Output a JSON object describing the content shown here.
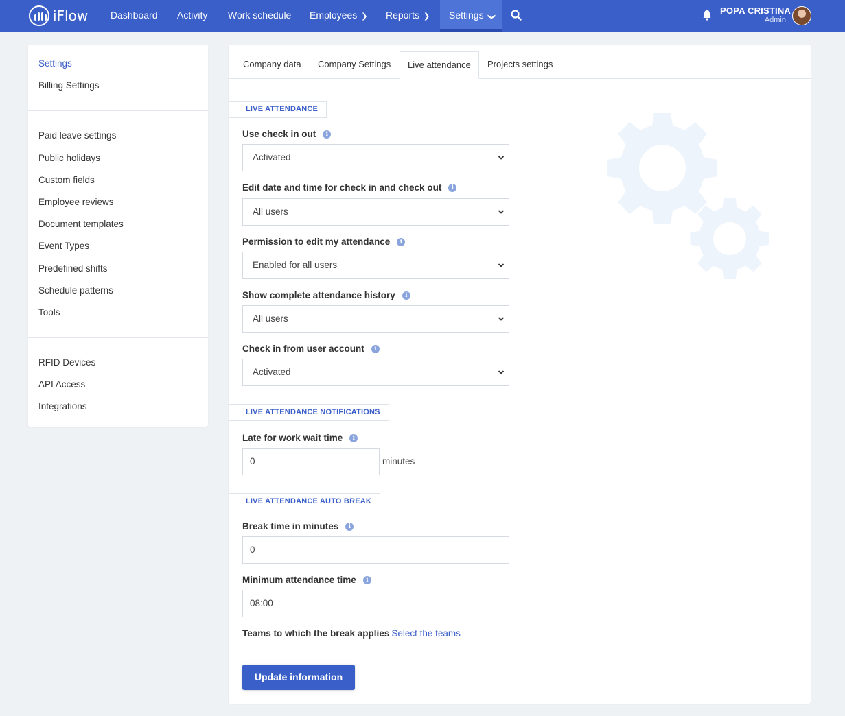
{
  "app": {
    "name": "iFlow"
  },
  "nav": {
    "items": [
      {
        "label": "Dashboard",
        "has_chevron": false
      },
      {
        "label": "Activity",
        "has_chevron": false
      },
      {
        "label": "Work schedule",
        "has_chevron": false
      },
      {
        "label": "Employees",
        "has_chevron": true
      },
      {
        "label": "Reports",
        "has_chevron": true
      },
      {
        "label": "Settings",
        "has_chevron": true,
        "active": true
      }
    ],
    "search_icon": "search-icon",
    "bell_icon": "bell-icon"
  },
  "user": {
    "name": "POPA CRISTINA",
    "role": "Admin"
  },
  "sidebar": {
    "group1": [
      "Settings",
      "Billing Settings"
    ],
    "group2": [
      "Paid leave settings",
      "Public holidays",
      "Custom fields",
      "Employee reviews",
      "Document templates",
      "Event Types",
      "Predefined shifts",
      "Schedule patterns",
      "Tools"
    ],
    "group3": [
      "RFID Devices",
      "API Access",
      "Integrations"
    ],
    "active": "Settings"
  },
  "tabs": [
    "Company data",
    "Company Settings",
    "Live attendance",
    "Projects settings"
  ],
  "active_tab": "Live attendance",
  "sections": {
    "live_attendance": "LIVE ATTENDANCE",
    "notifications": "LIVE ATTENDANCE NOTIFICATIONS",
    "auto_break": "LIVE ATTENDANCE AUTO BREAK"
  },
  "fields": {
    "use_check_in_out": {
      "label": "Use check in out",
      "value": "Activated"
    },
    "edit_date_time": {
      "label": "Edit date and time for check in and check out",
      "value": "All users"
    },
    "permission_edit": {
      "label": "Permission to edit my attendance",
      "value": "Enabled for all users"
    },
    "show_history": {
      "label": "Show complete attendance history",
      "value": "All users"
    },
    "check_in_user_account": {
      "label": "Check in from user account",
      "value": "Activated"
    },
    "late_wait_time": {
      "label": "Late for work wait time",
      "value": "0",
      "suffix": "minutes"
    },
    "break_time": {
      "label": "Break time in minutes",
      "value": "0"
    },
    "min_attendance": {
      "label": "Minimum attendance time",
      "value": "08:00"
    },
    "teams": {
      "label": "Teams to which the break applies",
      "link": "Select the teams"
    }
  },
  "buttons": {
    "update": "Update information"
  },
  "colors": {
    "primary": "#3a5fc8",
    "background": "#eff2f5",
    "gear": "#eef4fc"
  }
}
